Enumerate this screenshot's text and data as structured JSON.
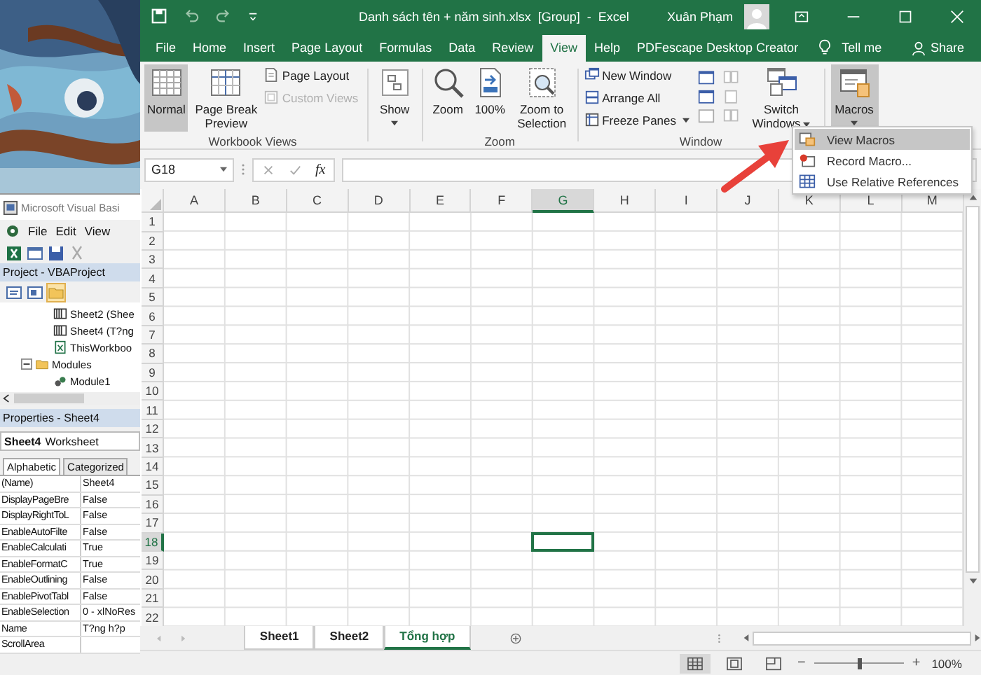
{
  "vbe": {
    "title": "Microsoft Visual Basi",
    "menu": [
      {
        "label": "File"
      },
      {
        "label": "Edit"
      },
      {
        "label": "View"
      }
    ],
    "project_title": "Project - VBAProject",
    "tree": [
      {
        "label": "Sheet2 (Shee",
        "kind": "sheet"
      },
      {
        "label": "Sheet4 (T?ng",
        "kind": "sheet"
      },
      {
        "label": "ThisWorkboo",
        "kind": "workbook"
      },
      {
        "label": "Modules",
        "kind": "folder",
        "expanded": true,
        "children": [
          {
            "label": "Module1",
            "kind": "module"
          }
        ]
      }
    ],
    "properties_title": "Properties - Sheet4",
    "object": {
      "name": "Sheet4",
      "type": "Worksheet"
    },
    "prop_tabs": [
      {
        "label": "Alphabetic",
        "selected": true
      },
      {
        "label": "Categorized",
        "selected": false
      }
    ],
    "props": [
      {
        "name": "(Name)",
        "value": "Sheet4"
      },
      {
        "name": "DisplayPageBre",
        "value": "False"
      },
      {
        "name": "DisplayRightToL",
        "value": "False"
      },
      {
        "name": "EnableAutoFilte",
        "value": "False"
      },
      {
        "name": "EnableCalculati",
        "value": "True"
      },
      {
        "name": "EnableFormatC",
        "value": "True"
      },
      {
        "name": "EnableOutlining",
        "value": "False"
      },
      {
        "name": "EnablePivotTabl",
        "value": "False"
      },
      {
        "name": "EnableSelection",
        "value": "0 - xlNoRes"
      },
      {
        "name": "Name",
        "value": "T?ng h?p"
      },
      {
        "name": "ScrollArea"
      }
    ]
  },
  "excel": {
    "title": "Danh sách tên + năm sinh.xlsx  [Group]  -  Excel",
    "user": "Xuân Phạm",
    "tabs": [
      {
        "label": "File",
        "selected": false
      },
      {
        "label": "Home",
        "selected": false
      },
      {
        "label": "Insert",
        "selected": false
      },
      {
        "label": "Page Layout",
        "selected": false
      },
      {
        "label": "Formulas",
        "selected": false
      },
      {
        "label": "Data",
        "selected": false
      },
      {
        "label": "Review",
        "selected": false
      },
      {
        "label": "View",
        "selected": true
      },
      {
        "label": "Help",
        "selected": false
      },
      {
        "label": "PDFescape Desktop Creator",
        "selected": false
      }
    ],
    "tell_me": "Tell me",
    "share": "Share",
    "ribbon": {
      "workbook_views": {
        "label": "Workbook Views",
        "normal": {
          "label": "Normal",
          "selected": true
        },
        "page_break": {
          "label": "Page Break Preview",
          "selected": false
        },
        "page_layout": {
          "label": "Page Layout",
          "disabled": false
        },
        "custom_views": {
          "label": "Custom Views",
          "disabled": true
        }
      },
      "show": {
        "label": "Show"
      },
      "zoom": {
        "label": "Zoom",
        "zoom": "Zoom",
        "hundred": "100%",
        "selection": "Zoom to Selection"
      },
      "window": {
        "label": "Window",
        "new_window": "New Window",
        "arrange_all": "Arrange All",
        "freeze_panes": "Freeze Panes",
        "switch_windows": "Switch Windows"
      },
      "macros": {
        "label": "Macros",
        "pressed": true
      }
    },
    "macros_menu": [
      {
        "label": "View Macros",
        "selected": true
      },
      {
        "label": "Record Macro...",
        "selected": false
      },
      {
        "label": "Use Relative References",
        "selected": false
      }
    ],
    "name_box": "G18",
    "fx": "fx",
    "columns": [
      {
        "label": "A",
        "selected": false
      },
      {
        "label": "B",
        "selected": false
      },
      {
        "label": "C",
        "selected": false
      },
      {
        "label": "D",
        "selected": false
      },
      {
        "label": "E",
        "selected": false
      },
      {
        "label": "F",
        "selected": false
      },
      {
        "label": "G",
        "selected": true
      },
      {
        "label": "H",
        "selected": false
      },
      {
        "label": "I",
        "selected": false
      },
      {
        "label": "J",
        "selected": false
      },
      {
        "label": "K",
        "selected": false
      },
      {
        "label": "L",
        "selected": false
      },
      {
        "label": "M",
        "selected": false
      }
    ],
    "rows": [
      {
        "label": "1",
        "selected": false
      },
      {
        "label": "2",
        "selected": false
      },
      {
        "label": "3",
        "selected": false
      },
      {
        "label": "4",
        "selected": false
      },
      {
        "label": "5",
        "selected": false
      },
      {
        "label": "6",
        "selected": false
      },
      {
        "label": "7",
        "selected": false
      },
      {
        "label": "8",
        "selected": false
      },
      {
        "label": "9",
        "selected": false
      },
      {
        "label": "10",
        "selected": false
      },
      {
        "label": "11",
        "selected": false
      },
      {
        "label": "12",
        "selected": false
      },
      {
        "label": "13",
        "selected": false
      },
      {
        "label": "14",
        "selected": false
      },
      {
        "label": "15",
        "selected": false
      },
      {
        "label": "16",
        "selected": false
      },
      {
        "label": "17",
        "selected": false
      },
      {
        "label": "18",
        "selected": true
      },
      {
        "label": "19",
        "selected": false
      },
      {
        "label": "20",
        "selected": false
      },
      {
        "label": "21",
        "selected": false
      },
      {
        "label": "22",
        "selected": false
      }
    ],
    "sheets": [
      {
        "label": "Sheet1",
        "selected": false
      },
      {
        "label": "Sheet2",
        "selected": false
      },
      {
        "label": "Tổng hợp",
        "selected": true
      }
    ],
    "zoom": {
      "minus": "−",
      "plus": "+",
      "level": 0.5,
      "reading": "100%"
    }
  }
}
